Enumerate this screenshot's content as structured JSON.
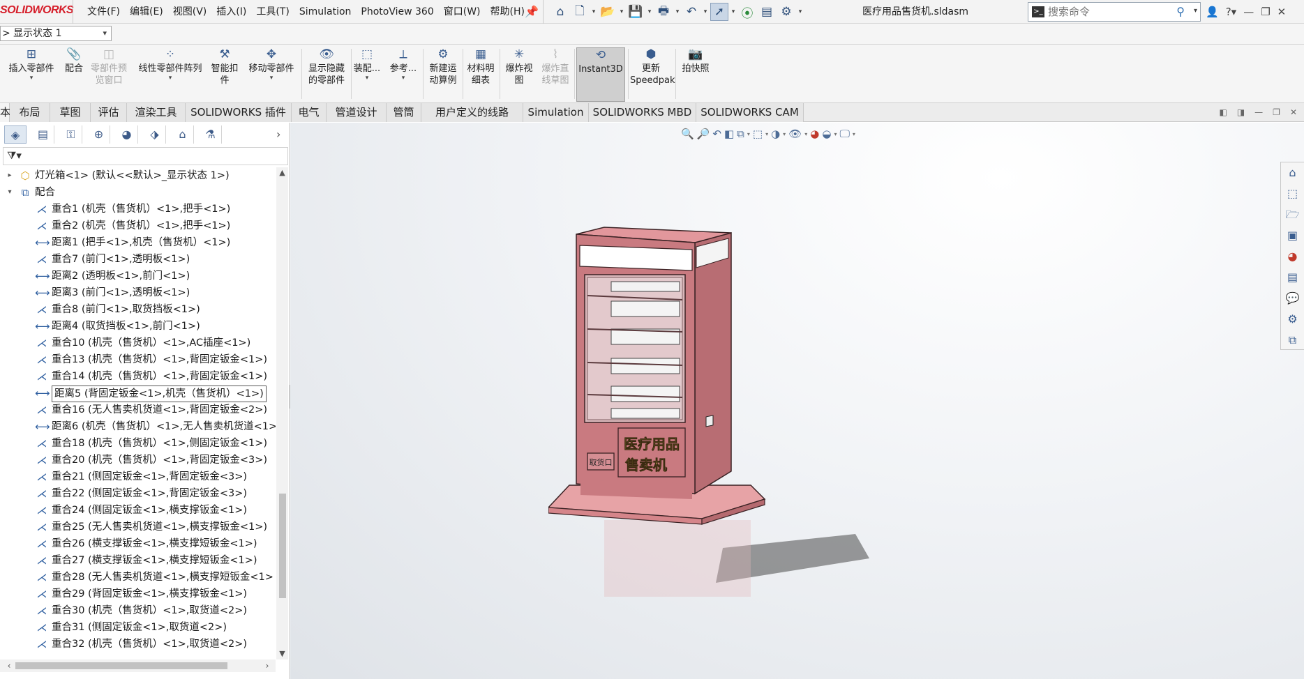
{
  "app": {
    "logo_text_solid": "SOLID",
    "logo_text_works": "WORKS",
    "document_title": "医疗用品售货机.sldasm"
  },
  "menu": [
    "文件(F)",
    "编辑(E)",
    "视图(V)",
    "插入(I)",
    "工具(T)",
    "Simulation",
    "PhotoView 360",
    "窗口(W)",
    "帮助(H)"
  ],
  "search": {
    "placeholder": "搜索命令"
  },
  "config": {
    "value": ">  显示状态 1"
  },
  "commands": [
    {
      "label": "插入零部件",
      "icon": "insert-component-icon",
      "enabled": true
    },
    {
      "label": "配合",
      "icon": "mate-icon",
      "enabled": true
    },
    {
      "label": "零部件预览窗口",
      "icon": "component-preview-icon",
      "enabled": false
    },
    {
      "label": "线性零部件阵列",
      "icon": "linear-pattern-icon",
      "enabled": true
    },
    {
      "label": "智能扣件",
      "icon": "smart-fasteners-icon",
      "enabled": true
    },
    {
      "label": "移动零部件",
      "icon": "move-component-icon",
      "enabled": true
    },
    {
      "label": "显示隐藏的零部件",
      "icon": "show-hidden-icon",
      "enabled": true
    },
    {
      "label": "装配...",
      "icon": "assembly-features-icon",
      "enabled": true
    },
    {
      "label": "参考...",
      "icon": "reference-geometry-icon",
      "enabled": true
    },
    {
      "label": "新建运动算例",
      "icon": "new-motion-study-icon",
      "enabled": true
    },
    {
      "label": "材料明细表",
      "icon": "bom-icon",
      "enabled": true
    },
    {
      "label": "爆炸视图",
      "icon": "exploded-view-icon",
      "enabled": true
    },
    {
      "label": "爆炸直线草图",
      "icon": "explode-line-sketch-icon",
      "enabled": false
    },
    {
      "label": "Instant3D",
      "icon": "instant3d-icon",
      "enabled": true
    },
    {
      "label": "更新Speedpak",
      "icon": "update-speedpak-icon",
      "enabled": true
    },
    {
      "label": "拍快照",
      "icon": "snapshot-icon",
      "enabled": true
    }
  ],
  "tabs": [
    "本",
    "布局",
    "草图",
    "评估",
    "渲染工具",
    "SOLIDWORKS 插件",
    "电气",
    "管道设计",
    "管筒",
    "用户定义的线路",
    "Simulation",
    "SOLIDWORKS MBD",
    "SOLIDWORKS CAM"
  ],
  "tree": {
    "component": "灯光箱<1> (默认<<默认>_显示状态 1>)",
    "mates_folder": "配合",
    "mates": [
      {
        "type": "coincident",
        "label": "重合1 (机壳（售货机）<1>,把手<1>)"
      },
      {
        "type": "coincident",
        "label": "重合2 (机壳（售货机）<1>,把手<1>)"
      },
      {
        "type": "distance",
        "label": "距离1 (把手<1>,机壳（售货机）<1>)"
      },
      {
        "type": "coincident",
        "label": "重合7 (前门<1>,透明板<1>)"
      },
      {
        "type": "distance",
        "label": "距离2 (透明板<1>,前门<1>)"
      },
      {
        "type": "distance",
        "label": "距离3 (前门<1>,透明板<1>)"
      },
      {
        "type": "coincident",
        "label": "重合8 (前门<1>,取货挡板<1>)"
      },
      {
        "type": "distance",
        "label": "距离4 (取货挡板<1>,前门<1>)"
      },
      {
        "type": "coincident",
        "label": "重合10 (机壳（售货机）<1>,AC插座<1>)"
      },
      {
        "type": "coincident",
        "label": "重合13 (机壳（售货机）<1>,背固定钣金<1>)"
      },
      {
        "type": "coincident",
        "label": "重合14 (机壳（售货机）<1>,背固定钣金<1>)"
      },
      {
        "type": "distance",
        "label": "距离5 (背固定钣金<1>,机壳（售货机）<1>)",
        "selected": true
      },
      {
        "type": "coincident",
        "label": "重合16 (无人售卖机货道<1>,背固定钣金<2>)"
      },
      {
        "type": "distance",
        "label": "距离6 (机壳（售货机）<1>,无人售卖机货道<1>"
      },
      {
        "type": "coincident",
        "label": "重合18 (机壳（售货机）<1>,侧固定钣金<1>)"
      },
      {
        "type": "coincident",
        "label": "重合20 (机壳（售货机）<1>,背固定钣金<3>)"
      },
      {
        "type": "coincident",
        "label": "重合21 (侧固定钣金<1>,背固定钣金<3>)"
      },
      {
        "type": "coincident",
        "label": "重合22 (侧固定钣金<1>,背固定钣金<3>)"
      },
      {
        "type": "coincident",
        "label": "重合24 (侧固定钣金<1>,横支撑钣金<1>)"
      },
      {
        "type": "coincident",
        "label": "重合25 (无人售卖机货道<1>,横支撑钣金<1>)"
      },
      {
        "type": "coincident",
        "label": "重合26 (横支撑钣金<1>,横支撑短钣金<1>)"
      },
      {
        "type": "coincident",
        "label": "重合27 (横支撑钣金<1>,横支撑短钣金<1>)"
      },
      {
        "type": "coincident",
        "label": "重合28 (无人售卖机货道<1>,横支撑短钣金<1>"
      },
      {
        "type": "coincident",
        "label": "重合29 (背固定钣金<1>,横支撑钣金<1>)"
      },
      {
        "type": "coincident",
        "label": "重合30 (机壳（售货机）<1>,取货道<2>)"
      },
      {
        "type": "coincident",
        "label": "重合31 (侧固定钣金<1>,取货道<2>)"
      },
      {
        "type": "coincident",
        "label": "重合32 (机壳（售货机）<1>,取货道<2>)"
      }
    ]
  },
  "model": {
    "panel_text_line1": "医疗用品",
    "panel_text_line2": "售卖机",
    "pickup_label": "取货口",
    "body_color": "#c97a80",
    "edge_color": "#3a2224",
    "base_color": "#e7a3a6"
  }
}
